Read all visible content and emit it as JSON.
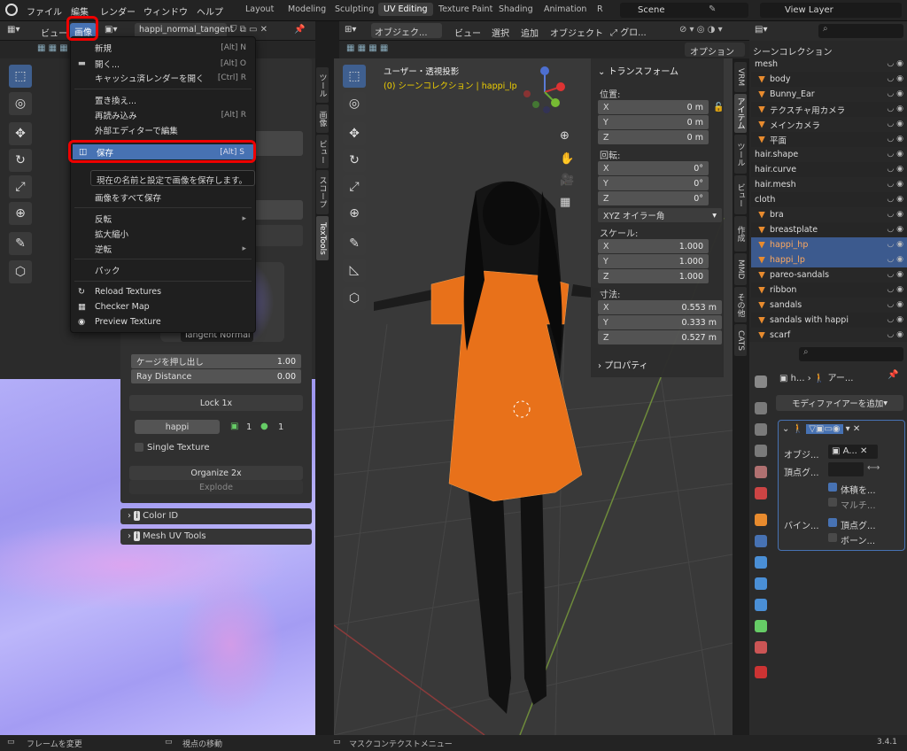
{
  "topbar": {
    "menus": [
      "ファイル",
      "編集",
      "レンダー",
      "ウィンドウ",
      "ヘルプ"
    ],
    "workspaces": [
      "Layout",
      "Modeling",
      "Sculpting",
      "UV Editing",
      "Texture Paint",
      "Shading",
      "Animation",
      "R"
    ],
    "active_workspace": "UV Editing",
    "scene": "Scene",
    "view_layer": "View Layer"
  },
  "image_editor": {
    "header_view": "ビュー",
    "header_image": "画像",
    "image_name": "happi_normal_tangent",
    "side_tabs": [
      "ツール",
      "画像",
      "ビュー",
      "スコープ",
      "TexTools"
    ],
    "panel": {
      "tangent_normal": "Tangent Normal",
      "cage_label": "ケージを押し出し",
      "cage_value": "1.00",
      "ray_label": "Ray Distance",
      "ray_value": "0.00",
      "lock_label": "Lock 1x",
      "material_name": "happi",
      "count1": "1",
      "count2": "1",
      "single_texture": "Single Texture",
      "organize_label": "Organize 2x",
      "explode_label": "Explode",
      "color_id": "Color ID",
      "mesh_uv_tools": "Mesh UV Tools"
    }
  },
  "image_menu": {
    "items": [
      {
        "label": "新規",
        "shortcut": "[Alt] N"
      },
      {
        "label": "開く...",
        "shortcut": "[Alt] O"
      },
      {
        "label": "キャッシュ済レンダーを開く",
        "shortcut": "[Ctrl] R"
      },
      {
        "label": "置き換え...",
        "shortcut": ""
      },
      {
        "label": "再読み込み",
        "shortcut": "[Alt] R"
      },
      {
        "label": "外部エディターで編集",
        "shortcut": ""
      },
      {
        "label": "保存",
        "shortcut": "[Alt] S"
      },
      {
        "label": "画像をすべて保存",
        "shortcut": ""
      },
      {
        "label": "反転",
        "shortcut": ""
      },
      {
        "label": "拡大縮小",
        "shortcut": ""
      },
      {
        "label": "逆転",
        "shortcut": ""
      },
      {
        "label": "パック",
        "shortcut": ""
      },
      {
        "label": "Reload Textures",
        "shortcut": ""
      },
      {
        "label": "Checker Map",
        "shortcut": ""
      },
      {
        "label": "Preview Texture",
        "shortcut": ""
      }
    ],
    "tooltip": "現在の名前と設定で画像を保存します。"
  },
  "viewport": {
    "mode": "オブジェク...",
    "menus": [
      "ビュー",
      "選択",
      "追加",
      "オブジェクト"
    ],
    "orientation": "グロ...",
    "options": "オプション",
    "title": "ユーザー・透視投影",
    "subtitle": "(0) シーンコレクション | happi_lp",
    "side_tabs": [
      "VRM",
      "アイテム",
      "ツール",
      "ビュー",
      "作成",
      "MMD",
      "その他",
      "CATS"
    ]
  },
  "transform": {
    "title": "トランスフォーム",
    "loc_label": "位置:",
    "loc": [
      {
        "a": "X",
        "v": "0 m"
      },
      {
        "a": "Y",
        "v": "0 m"
      },
      {
        "a": "Z",
        "v": "0 m"
      }
    ],
    "rot_label": "回転:",
    "rot": [
      {
        "a": "X",
        "v": "0°"
      },
      {
        "a": "Y",
        "v": "0°"
      },
      {
        "a": "Z",
        "v": "0°"
      }
    ],
    "rot_mode": "XYZ オイラー角",
    "scale_label": "スケール:",
    "scale": [
      {
        "a": "X",
        "v": "1.000"
      },
      {
        "a": "Y",
        "v": "1.000"
      },
      {
        "a": "Z",
        "v": "1.000"
      }
    ],
    "dim_label": "寸法:",
    "dim": [
      {
        "a": "X",
        "v": "0.553 m"
      },
      {
        "a": "Y",
        "v": "0.333 m"
      },
      {
        "a": "Z",
        "v": "0.527 m"
      }
    ],
    "properties": "プロパティ"
  },
  "outliner": {
    "header": "シーンコレクション",
    "rows": [
      {
        "label": "mesh",
        "kind": "collection"
      },
      {
        "label": "body",
        "kind": "obj"
      },
      {
        "label": "Bunny_Ear",
        "kind": "obj"
      },
      {
        "label": "テクスチャ用カメラ",
        "kind": "obj"
      },
      {
        "label": "メインカメラ",
        "kind": "obj"
      },
      {
        "label": "平面",
        "kind": "obj"
      },
      {
        "label": "hair.shape",
        "kind": "collection"
      },
      {
        "label": "hair.curve",
        "kind": "collection"
      },
      {
        "label": "hair.mesh",
        "kind": "collection"
      },
      {
        "label": "cloth",
        "kind": "collection"
      },
      {
        "label": "bra",
        "kind": "obj"
      },
      {
        "label": "breastplate",
        "kind": "obj"
      },
      {
        "label": "happi_hp",
        "kind": "sel"
      },
      {
        "label": "happi_lp",
        "kind": "sel"
      },
      {
        "label": "pareo-sandals",
        "kind": "obj"
      },
      {
        "label": "ribbon",
        "kind": "obj"
      },
      {
        "label": "sandals",
        "kind": "obj"
      },
      {
        "label": "sandals with happi",
        "kind": "obj"
      },
      {
        "label": "scarf",
        "kind": "obj"
      }
    ]
  },
  "properties": {
    "obj_short": "h...",
    "arm_short": "アー...",
    "add_modifier": "モディファイアーを追加",
    "object_label": "オブジ...",
    "object_value": "A...",
    "vgroup_label": "頂点グ...",
    "preserve_volume": "体積を...",
    "multi": "マルチ...",
    "bind_label": "バイン...",
    "vertex_groups": "頂点グ...",
    "bone": "ボーン..."
  },
  "statusbar": {
    "left": "フレームを変更",
    "mid": "視点の移動",
    "right": "マスクコンテクストメニュー",
    "version": "3.4.1"
  },
  "colors": {
    "accent": "#4772b3",
    "highlight_red": "#e00000",
    "orange": "#e8711a"
  }
}
